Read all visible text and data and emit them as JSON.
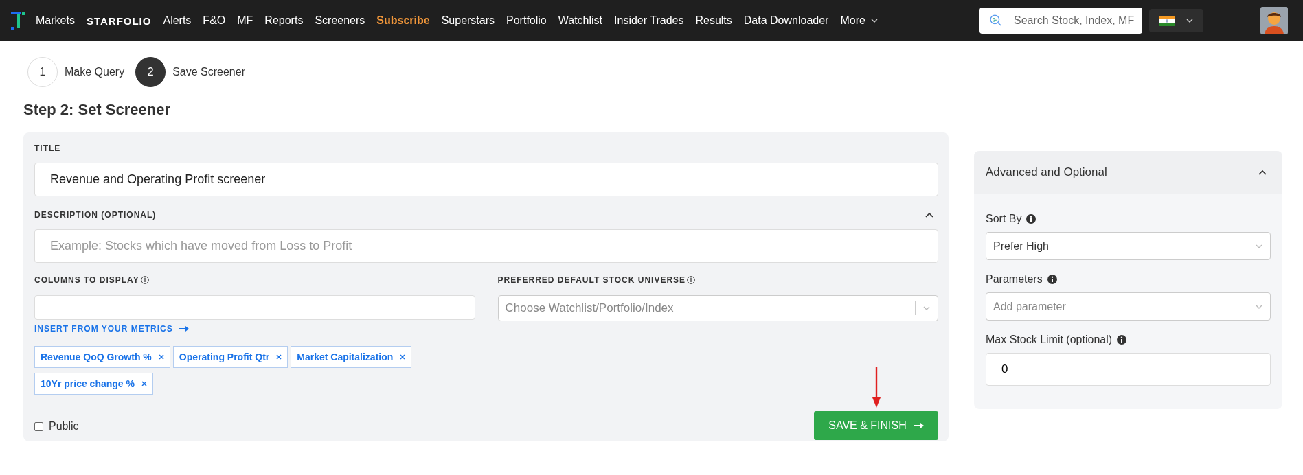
{
  "nav": {
    "items": [
      {
        "label": "Markets",
        "kind": "link",
        "highlighted": false,
        "has_menu": false
      },
      {
        "label": "STARFOLIO",
        "kind": "brand",
        "highlighted": false,
        "has_menu": false
      },
      {
        "label": "Alerts",
        "kind": "link",
        "highlighted": false,
        "has_menu": false
      },
      {
        "label": "F&O",
        "kind": "link",
        "highlighted": false,
        "has_menu": false
      },
      {
        "label": "MF",
        "kind": "link",
        "highlighted": false,
        "has_menu": false
      },
      {
        "label": "Reports",
        "kind": "link",
        "highlighted": false,
        "has_menu": false
      },
      {
        "label": "Screeners",
        "kind": "link",
        "highlighted": false,
        "has_menu": false
      },
      {
        "label": "Subscribe",
        "kind": "link",
        "highlighted": true,
        "has_menu": false
      },
      {
        "label": "Superstars",
        "kind": "link",
        "highlighted": false,
        "has_menu": false
      },
      {
        "label": "Portfolio",
        "kind": "link",
        "highlighted": false,
        "has_menu": false
      },
      {
        "label": "Watchlist",
        "kind": "link",
        "highlighted": false,
        "has_menu": false
      },
      {
        "label": "Insider Trades",
        "kind": "link",
        "highlighted": false,
        "has_menu": false
      },
      {
        "label": "Results",
        "kind": "link",
        "highlighted": false,
        "has_menu": false
      },
      {
        "label": "Data Downloader",
        "kind": "link",
        "highlighted": false,
        "has_menu": false
      },
      {
        "label": "More",
        "kind": "link",
        "highlighted": false,
        "has_menu": true
      }
    ],
    "search": {
      "placeholder": "Search Stock, Index, MF"
    }
  },
  "steps": [
    {
      "number": "1",
      "label": "Make Query",
      "selected": false
    },
    {
      "number": "2",
      "label": "Save Screener",
      "selected": true
    }
  ],
  "heading": "Step 2: Set Screener",
  "form": {
    "title": {
      "label": "TITLE",
      "value": "Revenue and Operating Profit screener"
    },
    "description": {
      "label": "DESCRIPTION (OPTIONAL)",
      "placeholder": "Example: Stocks which have moved from Loss to Profit",
      "expanded": true
    },
    "columns": {
      "label": "COLUMNS TO DISPLAY",
      "link": "INSERT FROM YOUR METRICS",
      "tags": [
        "Revenue QoQ Growth %",
        "Operating Profit Qtr",
        "Market Capitalization",
        "10Yr price change %"
      ]
    },
    "universe": {
      "label": "PREFERRED DEFAULT STOCK UNIVERSE",
      "placeholder": "Choose Watchlist/Portfolio/Index"
    },
    "public": {
      "label": "Public",
      "checked": false
    },
    "submit": "SAVE & FINISH"
  },
  "advanced": {
    "title": "Advanced and Optional",
    "expanded": true,
    "fields": [
      {
        "label": "Sort By",
        "kind": "select",
        "value": "Prefer High"
      },
      {
        "label": "Parameters",
        "kind": "select",
        "placeholder": "Add parameter"
      },
      {
        "label": "Max Stock Limit (optional)",
        "kind": "input",
        "value": "0"
      }
    ]
  }
}
